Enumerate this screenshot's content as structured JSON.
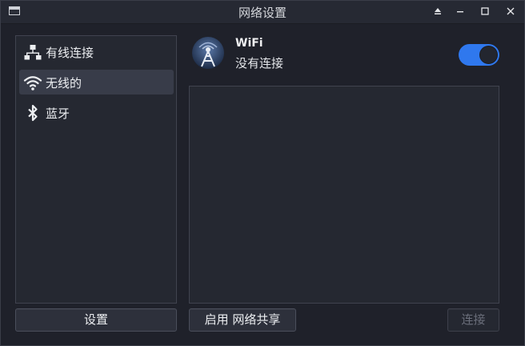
{
  "window": {
    "title": "网络设置",
    "controls": [
      "eject-icon",
      "minimize-icon",
      "maximize-icon",
      "close-icon"
    ]
  },
  "sidebar": {
    "items": [
      {
        "label": "有线连接",
        "icon": "wired-network-icon",
        "active": false
      },
      {
        "label": "无线的",
        "icon": "wifi-icon",
        "active": true
      },
      {
        "label": "蓝牙",
        "icon": "bluetooth-icon",
        "active": false
      }
    ]
  },
  "wifi": {
    "title": "WiFi",
    "status": "没有连接",
    "enabled": true,
    "icon": "wifi-tower-icon"
  },
  "buttons": {
    "settings": "设置",
    "enable_sharing": "启用 网络共享",
    "connect": "连接"
  },
  "colors": {
    "accent": "#2f78ee",
    "background": "#1f212a",
    "panel": "#252831"
  }
}
